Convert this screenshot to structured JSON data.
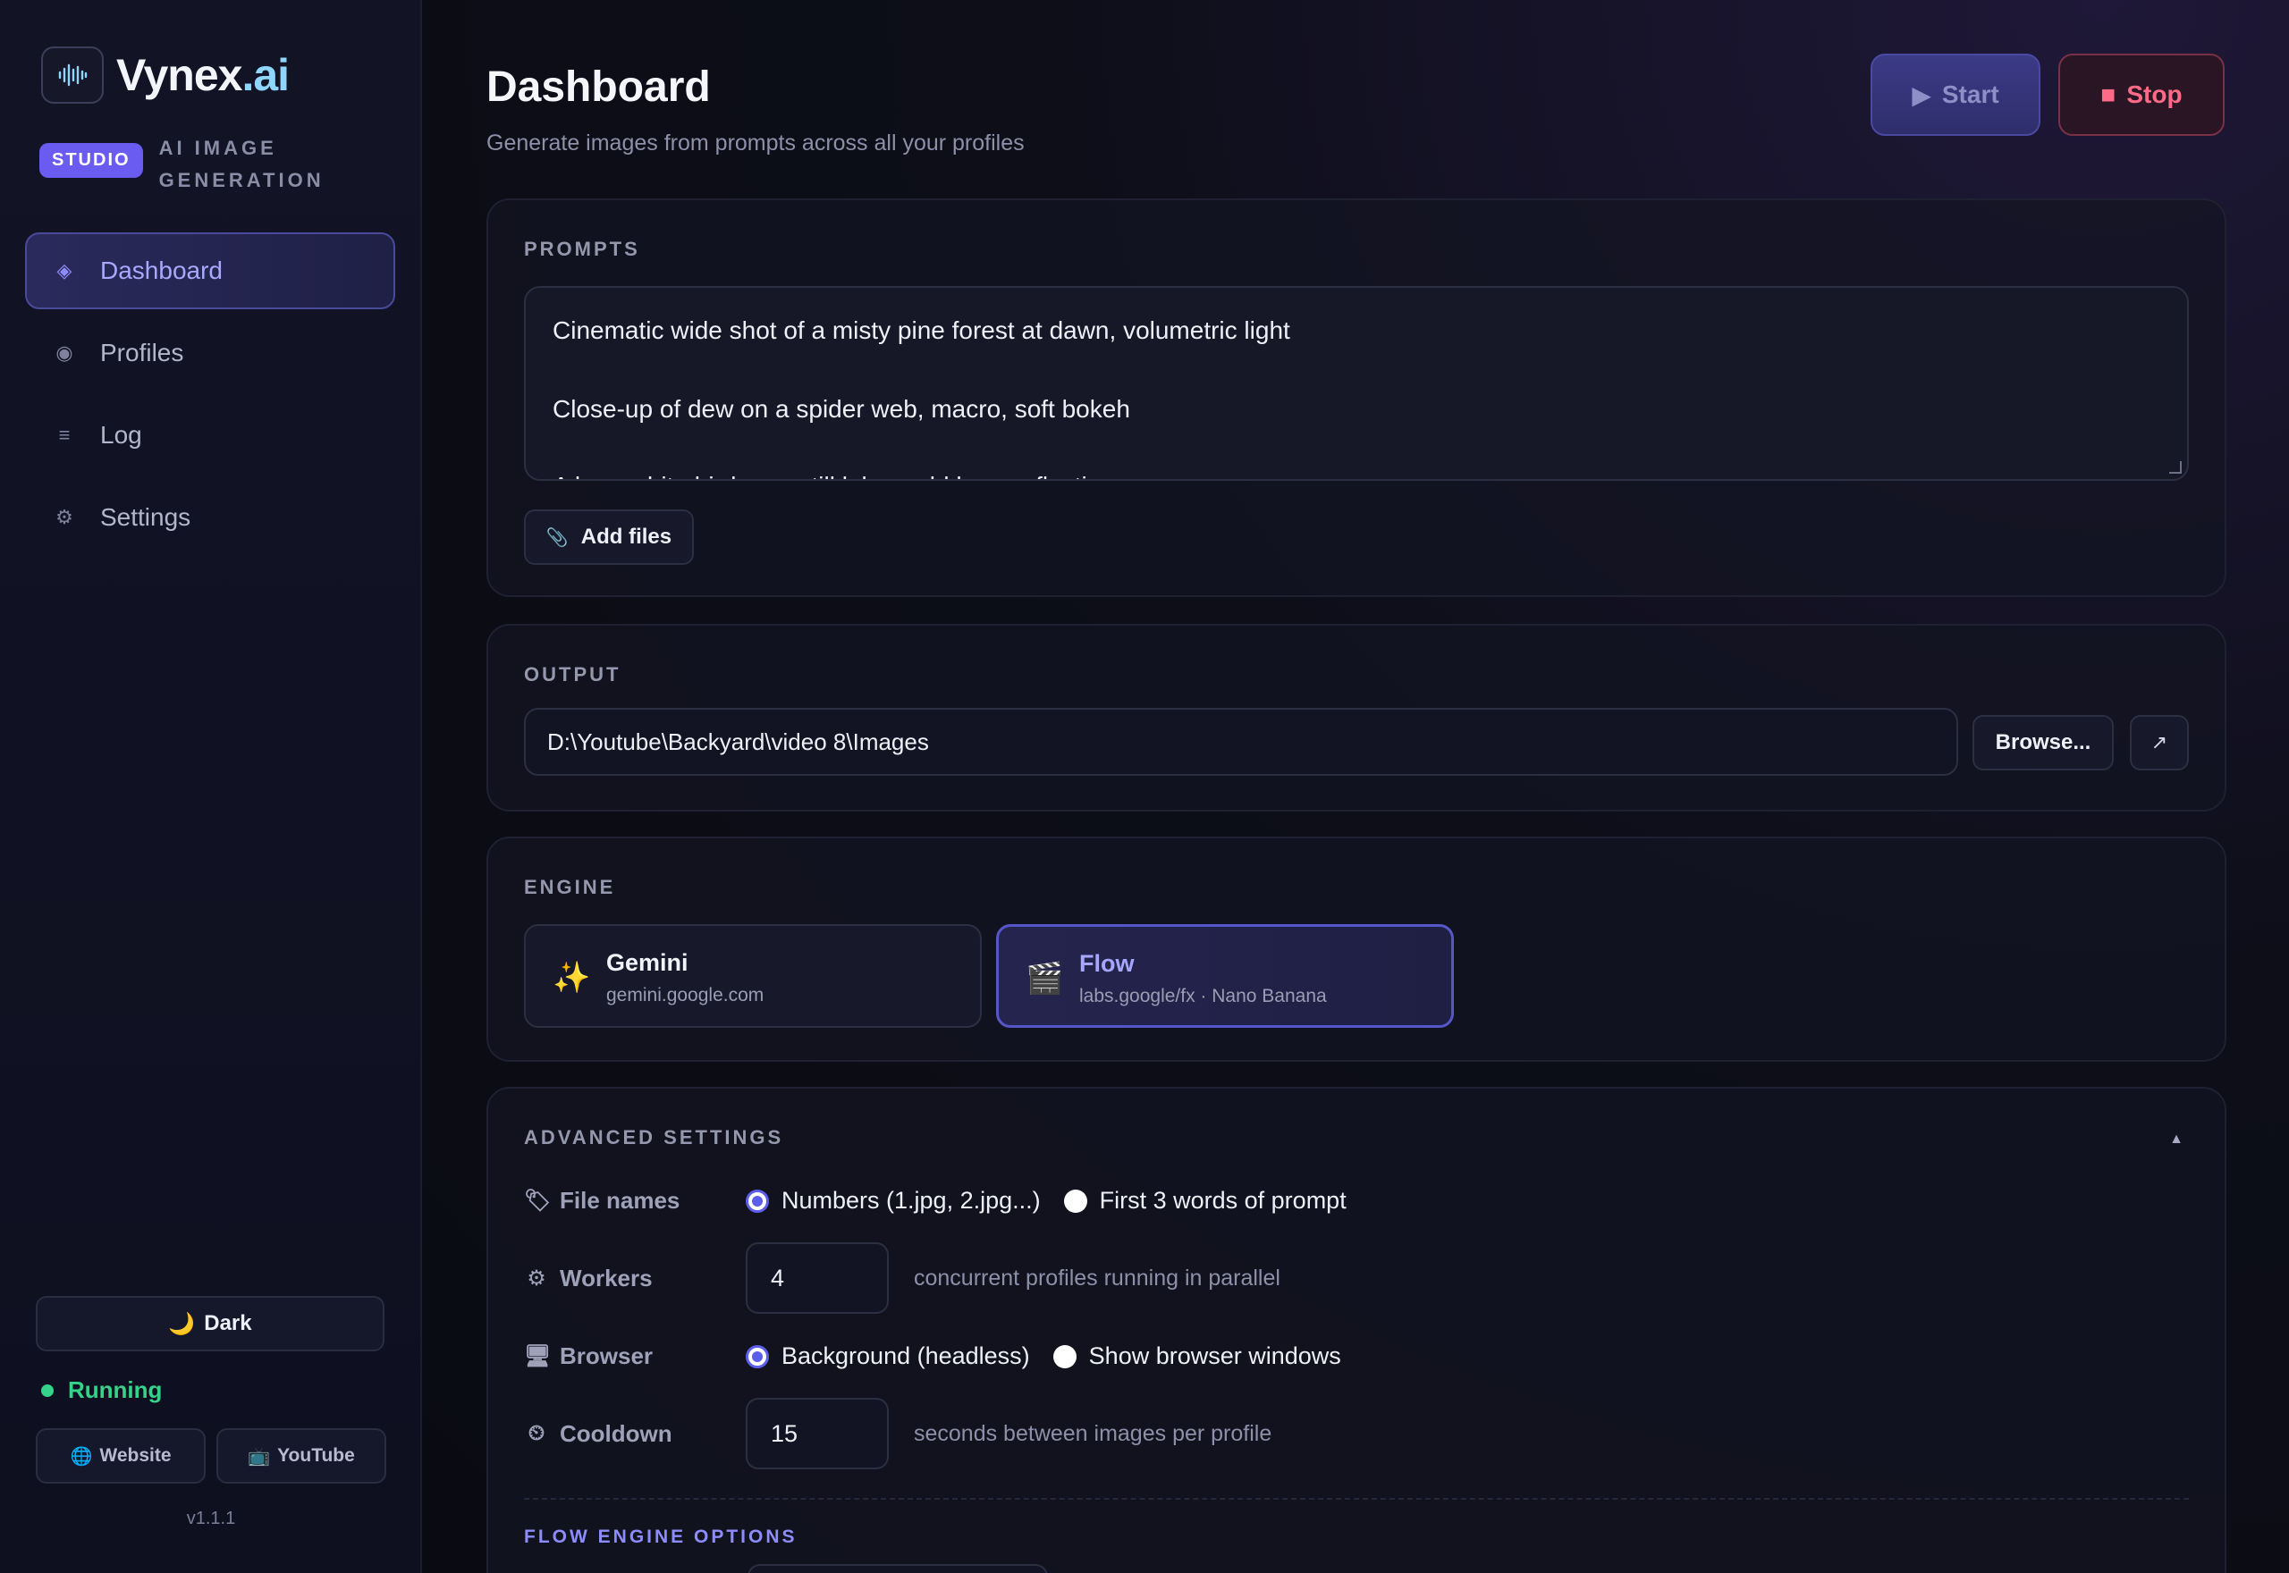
{
  "brand": {
    "name_main": "Vynex",
    "name_accent": ".ai",
    "badge": "STUDIO",
    "subtitle": "AI IMAGE GENERATION"
  },
  "nav": [
    {
      "label": "Dashboard",
      "icon": "diamond-icon",
      "glyph": "◈",
      "active": true
    },
    {
      "label": "Profiles",
      "icon": "profile-dot-icon",
      "glyph": "◉",
      "active": false
    },
    {
      "label": "Log",
      "icon": "list-icon",
      "glyph": "≡",
      "active": false
    },
    {
      "label": "Settings",
      "icon": "gear-icon",
      "glyph": "⚙",
      "active": false
    }
  ],
  "sidebar_footer": {
    "theme_label": "Dark",
    "status": "Running",
    "website_label": "Website",
    "youtube_label": "YouTube",
    "version": "v1.1.1"
  },
  "header": {
    "title": "Dashboard",
    "subtitle": "Generate images from prompts across all your profiles",
    "start_label": "Start",
    "stop_label": "Stop"
  },
  "prompts": {
    "label": "PROMPTS",
    "lines": [
      "Cinematic wide shot of a misty pine forest at dawn, volumetric light",
      "Close-up of dew on a spider web, macro, soft bokeh",
      "A lone white bird on a still lake, gold hour reflections"
    ],
    "add_files_label": "Add files"
  },
  "output": {
    "label": "OUTPUT",
    "path": "D:\\Youtube\\Backyard\\video 8\\Images",
    "browse_label": "Browse...",
    "open_glyph": "↗"
  },
  "engine": {
    "label": "ENGINE",
    "options": [
      {
        "name": "Gemini",
        "desc": "gemini.google.com",
        "icon": "sparkles-icon",
        "glyph": "✨",
        "selected": false
      },
      {
        "name": "Flow",
        "desc": "labs.google/fx · Nano Banana",
        "icon": "clapper-icon",
        "glyph": "🎬",
        "selected": true
      }
    ]
  },
  "advanced": {
    "label": "ADVANCED SETTINGS",
    "file_names": {
      "label": "File names",
      "option_a": "Numbers (1.jpg, 2.jpg...)",
      "option_b": "First 3 words of prompt",
      "selected": "option_a"
    },
    "workers": {
      "label": "Workers",
      "value": "4",
      "hint": "concurrent profiles running in parallel"
    },
    "browser": {
      "label": "Browser",
      "option_a": "Background (headless)",
      "option_b": "Show browser windows",
      "selected": "option_a"
    },
    "cooldown": {
      "label": "Cooldown",
      "value": "15",
      "hint": "seconds between images per profile"
    },
    "flow_section_label": "FLOW ENGINE OPTIONS"
  },
  "colors": {
    "accent": "#6a5cf0",
    "running": "#35d28a",
    "stop": "#ff6b86",
    "brand_accent": "#8fd6ff"
  }
}
